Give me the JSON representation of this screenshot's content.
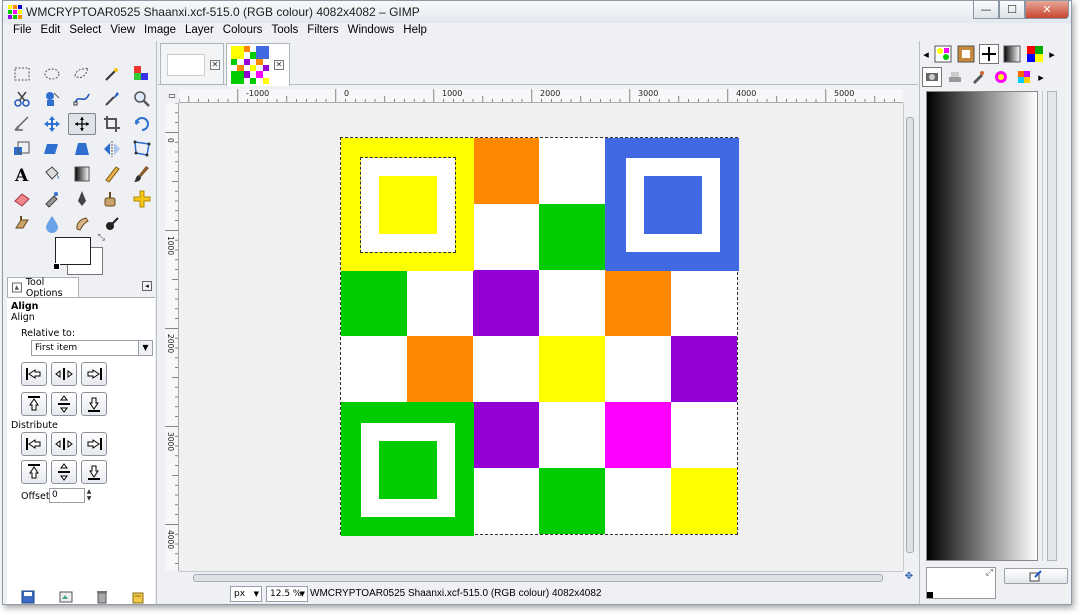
{
  "window": {
    "title": "WMCRYPTOAR0525 Shaanxi.xcf-515.0 (RGB colour) 4082x4082 – GIMP",
    "controls": {
      "minimize": "—",
      "maximize": "☐",
      "close": "✕"
    }
  },
  "menubar": {
    "items": [
      "File",
      "Edit",
      "Select",
      "View",
      "Image",
      "Layer",
      "Colours",
      "Tools",
      "Filters",
      "Windows",
      "Help"
    ]
  },
  "toolbox": {
    "tools": [
      "rect-select-icon",
      "ellipse-select-icon",
      "free-select-icon",
      "fuzzy-select-icon",
      "select-by-color-icon",
      "scissors-icon",
      "foreground-select-icon",
      "paths-icon",
      "color-picker-icon",
      "zoom-icon",
      "measure-icon",
      "move-icon",
      "align-icon",
      "crop-icon",
      "rotate-icon",
      "scale-icon",
      "shear-icon",
      "perspective-icon",
      "flip-icon",
      "cage-icon",
      "text-icon",
      "bucket-fill-icon",
      "blend-icon",
      "pencil-icon",
      "paintbrush-icon",
      "eraser-icon",
      "airbrush-icon",
      "ink-icon",
      "clone-icon",
      "heal-icon",
      "perspective-clone-icon",
      "blur-icon",
      "smudge-icon",
      "dodge-burn-icon"
    ],
    "active_tool": "align-icon"
  },
  "tool_options": {
    "tab_label": "Tool Options",
    "heading": "Align",
    "subheading": "Align",
    "relative_to_label": "Relative to:",
    "relative_to_value": "First item",
    "distribute_label": "Distribute",
    "offset_label": "Offset:",
    "offset_value": "0"
  },
  "image_tabs": [
    {
      "label": "blank-image"
    },
    {
      "label": "checker-image",
      "active": true
    }
  ],
  "rulers": {
    "h_ticks": [
      "-1000",
      "0",
      "1000",
      "2000",
      "3000",
      "4000",
      "5000"
    ],
    "v_ticks": [
      "0",
      "1000",
      "2000",
      "3000",
      "4000"
    ]
  },
  "status": {
    "unit": "px",
    "zoom": "12.5 %",
    "text": "WMCRYPTOAR0525 Shaanxi.xcf-515.0 (RGB colour) 4082x4082"
  },
  "colors": {
    "yellow": "#ffff00",
    "orange": "#ff8800",
    "green": "#00cc00",
    "blue": "#4169e1",
    "purple": "#9400d3",
    "magenta": "#ff00ff",
    "white": "#ffffff"
  },
  "checker_grid": [
    [
      "yellow",
      "yellow",
      "orange",
      "white",
      "blue",
      "blue"
    ],
    [
      "yellow",
      "yellow",
      "white",
      "green",
      "blue",
      "blue"
    ],
    [
      "green",
      "white",
      "purple",
      "white",
      "orange",
      "white"
    ],
    [
      "white",
      "orange",
      "white",
      "yellow",
      "white",
      "purple"
    ],
    [
      "green",
      "green",
      "purple",
      "white",
      "magenta",
      "white"
    ],
    [
      "green",
      "green",
      "white",
      "green",
      "white",
      "yellow"
    ]
  ],
  "dock": {
    "top_icons": [
      "brushes-icon",
      "patterns-icon",
      "gradients-icon",
      "palettes-icon",
      "fonts-icon"
    ],
    "second_row_icons": [
      "tool-options-icon",
      "device-status-icon",
      "paint-icon",
      "colour-icon",
      "palette-editor-icon"
    ]
  }
}
